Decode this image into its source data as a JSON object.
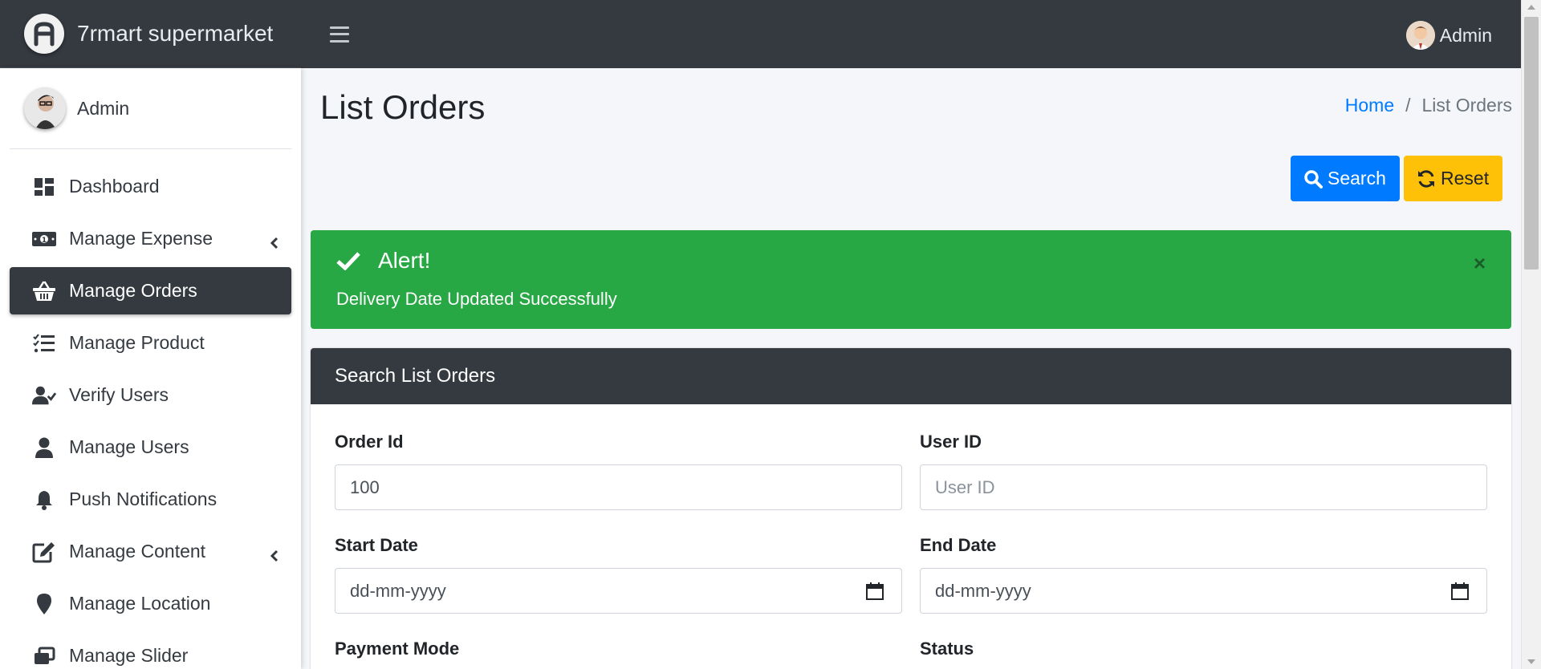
{
  "brand": {
    "name": "7rmart supermarket",
    "logo_icon": "brand-logo-icon"
  },
  "topbar": {
    "menu_icon": "hamburger-icon",
    "user_name": "Admin"
  },
  "sidebar": {
    "user_name": "Admin",
    "items": [
      {
        "label": "Dashboard",
        "icon": "dashboard-icon",
        "active": false,
        "has_caret": false
      },
      {
        "label": "Manage Expense",
        "icon": "money-bill-icon",
        "active": false,
        "has_caret": true
      },
      {
        "label": "Manage Orders",
        "icon": "basket-icon",
        "active": true,
        "has_caret": false
      },
      {
        "label": "Manage Product",
        "icon": "tasks-icon",
        "active": false,
        "has_caret": false
      },
      {
        "label": "Verify Users",
        "icon": "user-check-icon",
        "active": false,
        "has_caret": false
      },
      {
        "label": "Manage Users",
        "icon": "user-icon",
        "active": false,
        "has_caret": false
      },
      {
        "label": "Push Notifications",
        "icon": "bell-icon",
        "active": false,
        "has_caret": false
      },
      {
        "label": "Manage Content",
        "icon": "edit-icon",
        "active": false,
        "has_caret": true
      },
      {
        "label": "Manage Location",
        "icon": "map-marker-icon",
        "active": false,
        "has_caret": false
      },
      {
        "label": "Manage Slider",
        "icon": "slider-icon",
        "active": false,
        "has_caret": false
      }
    ]
  },
  "page": {
    "title": "List Orders"
  },
  "breadcrumb": {
    "home": "Home",
    "separator": "/",
    "current": "List Orders"
  },
  "actions": {
    "search_label": "Search",
    "reset_label": "Reset"
  },
  "alert": {
    "title": "Alert!",
    "message": "Delivery Date Updated Successfully",
    "close": "×"
  },
  "search_card": {
    "title": "Search List Orders",
    "order_id_label": "Order Id",
    "order_id_value": "100",
    "user_id_label": "User ID",
    "user_id_placeholder": "User ID",
    "start_date_label": "Start Date",
    "start_date_placeholder": "dd-mm-yyyy",
    "end_date_label": "End Date",
    "end_date_placeholder": "dd-mm-yyyy",
    "payment_mode_label": "Payment Mode",
    "status_label": "Status"
  },
  "colors": {
    "primary": "#007bff",
    "warning": "#ffc107",
    "success": "#28a745",
    "dark": "#343a40"
  }
}
